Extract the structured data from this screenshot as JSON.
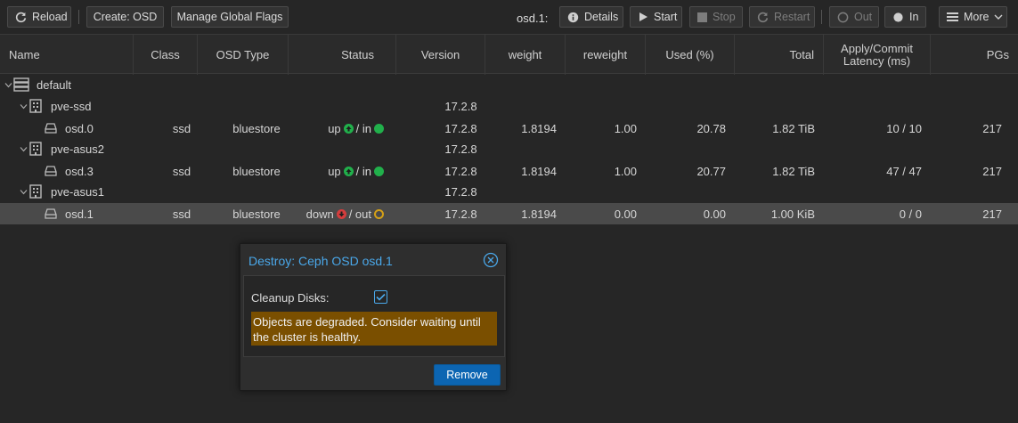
{
  "toolbar": {
    "reload": "Reload",
    "create_osd": "Create: OSD",
    "manage_flags": "Manage Global Flags",
    "selected_osd": "osd.1:",
    "details": "Details",
    "start": "Start",
    "stop": "Stop",
    "restart": "Restart",
    "out": "Out",
    "in": "In",
    "more": "More"
  },
  "columns": {
    "name": "Name",
    "class": "Class",
    "osd_type": "OSD Type",
    "status": "Status",
    "version": "Version",
    "weight": "weight",
    "reweight": "reweight",
    "used": "Used (%)",
    "total": "Total",
    "latency": "Apply/Commit Latency (ms)",
    "pgs": "PGs"
  },
  "rows": [
    {
      "name": "default",
      "class": "",
      "osd_type": "",
      "status_state": "",
      "status_in": "",
      "version": "",
      "weight": "",
      "reweight": "",
      "used": "",
      "total": "",
      "latency": "",
      "pgs": ""
    },
    {
      "name": "pve-ssd",
      "class": "",
      "osd_type": "",
      "status_state": "",
      "status_in": "",
      "version": "17.2.8",
      "weight": "",
      "reweight": "",
      "used": "",
      "total": "",
      "latency": "",
      "pgs": ""
    },
    {
      "name": "osd.0",
      "class": "ssd",
      "osd_type": "bluestore",
      "status_state": "up",
      "status_in": "/ in",
      "version": "17.2.8",
      "weight": "1.8194",
      "reweight": "1.00",
      "used": "20.78",
      "total": "1.82 TiB",
      "latency": "10 / 10",
      "pgs": "217"
    },
    {
      "name": "pve-asus2",
      "class": "",
      "osd_type": "",
      "status_state": "",
      "status_in": "",
      "version": "17.2.8",
      "weight": "",
      "reweight": "",
      "used": "",
      "total": "",
      "latency": "",
      "pgs": ""
    },
    {
      "name": "osd.3",
      "class": "ssd",
      "osd_type": "bluestore",
      "status_state": "up",
      "status_in": "/ in",
      "version": "17.2.8",
      "weight": "1.8194",
      "reweight": "1.00",
      "used": "20.77",
      "total": "1.82 TiB",
      "latency": "47 / 47",
      "pgs": "217"
    },
    {
      "name": "pve-asus1",
      "class": "",
      "osd_type": "",
      "status_state": "",
      "status_in": "",
      "version": "17.2.8",
      "weight": "",
      "reweight": "",
      "used": "",
      "total": "",
      "latency": "",
      "pgs": ""
    },
    {
      "name": "osd.1",
      "class": "ssd",
      "osd_type": "bluestore",
      "status_state": "down",
      "status_in": "/ out",
      "version": "17.2.8",
      "weight": "1.8194",
      "reweight": "0.00",
      "used": "0.00",
      "total": "1.00 KiB",
      "latency": "0 / 0",
      "pgs": "217"
    }
  ],
  "dialog": {
    "title": "Destroy: Ceph OSD osd.1",
    "cleanup_label": "Cleanup Disks:",
    "cleanup_checked": true,
    "warning": "Objects are degraded. Consider waiting until the cluster is healthy.",
    "remove": "Remove"
  },
  "colors": {
    "accent": "#4aa8ea",
    "ok": "#21b04b",
    "down": "#d43d3d",
    "out": "#d4a017",
    "warning_bg": "#7a4f00",
    "primary_button": "#0c65b2"
  }
}
